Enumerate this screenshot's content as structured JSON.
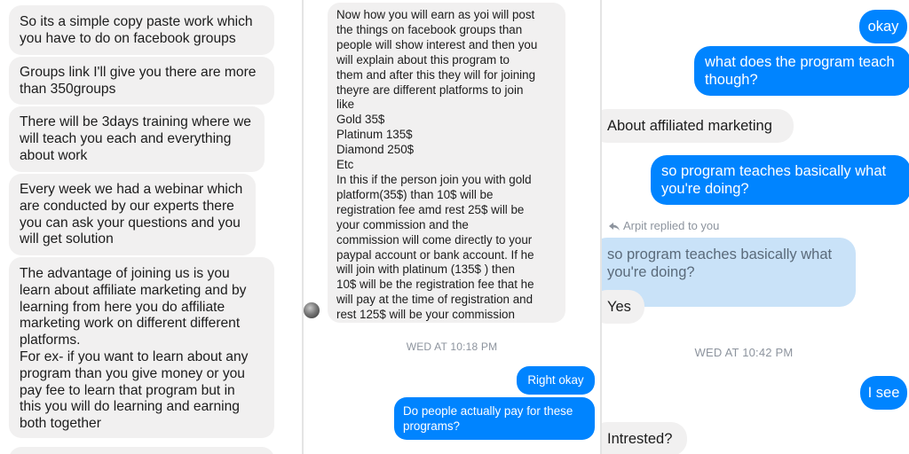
{
  "panel1": {
    "messages": [
      "So its a simple copy paste work which\nyou have to do on facebook groups",
      "Groups link I'll give you there are more\nthan 350groups",
      "There will be 3days training where we\nwill teach you each and everything\nabout work",
      "Every week we had a webinar which\nare conducted by our experts there\nyou can ask your questions and you\nwill get solution",
      "The advantage of joining us is you\nlearn about affiliate marketing and by\nlearning from here you do affiliate\nmarketing work on different different\nplatforms.\nFor ex- if you want to learn about any\nprogram than you give money or you\npay fee to learn that program but in\nthis you will do learning and earning\nboth together"
    ]
  },
  "panel2": {
    "long_message": "Now how you will earn as yoi will post\nthe things on facebook groups than\npeople will show interest and then you\nwill explain about this program to\nthem and after this they will for joining\ntheyre are different platforms to join\nlike\nGold 35$\nPlatinum 135$\nDiamond 250$\nEtc\nIn this if the person join you with gold\nplatform(35$) than 10$ will be\nregistration fee amd rest 25$ will be\nyour commission  and the\ncommission will come directly to your\npaypal account or bank account. If he\nwill join with platinum (135$ ) then\n10$ will be the registration fee that he\nwill pay at the time of registration and\nrest 125$ will be your commission",
    "timestamp": "WED AT 10:18 PM",
    "sent": [
      "Right okay",
      "Do people actually pay for these\nprograms?"
    ]
  },
  "panel3": {
    "sent_okay": "okay",
    "sent_question": "what does the program teach\nthough?",
    "received_affiliate": "About affiliated marketing",
    "sent_basically": "so program teaches basically what\nyou're doing?",
    "reply_label": "Arpit replied to you",
    "quoted_text": "so program teaches basically what\nyou're doing?",
    "received_yes": "Yes",
    "timestamp": "WED AT 10:42 PM",
    "sent_isee": "I see",
    "received_intrested": "Intrested?"
  },
  "colors": {
    "outgoing_bubble": "#0084ff",
    "incoming_bubble": "#f1f0f0",
    "quoted_bubble": "#c9e2f8",
    "timestamp": "#8d949e"
  }
}
